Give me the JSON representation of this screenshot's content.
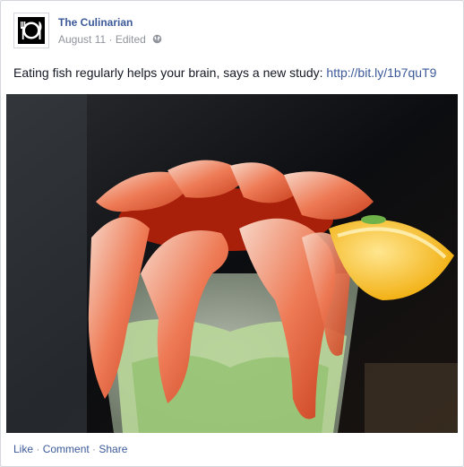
{
  "post": {
    "page_name": "The Culinarian",
    "date": "August 11",
    "meta_sep": " · ",
    "edited": "Edited",
    "audience_icon": "globe-icon",
    "avatar_icon": "plate-fork-knife-icon",
    "status_text": "Eating fish regularly helps your brain, says a new study: ",
    "status_link": "http://bit.ly/1b7quT9",
    "photo_subject": "shrimp-cocktail-photo"
  },
  "actions": {
    "like": "Like",
    "comment": "Comment",
    "share": "Share",
    "sep": " · "
  },
  "colors": {
    "link": "#3b5998",
    "meta": "#90949c",
    "text": "#141823",
    "border": "#d3d6db",
    "background": "#e9eaed"
  }
}
